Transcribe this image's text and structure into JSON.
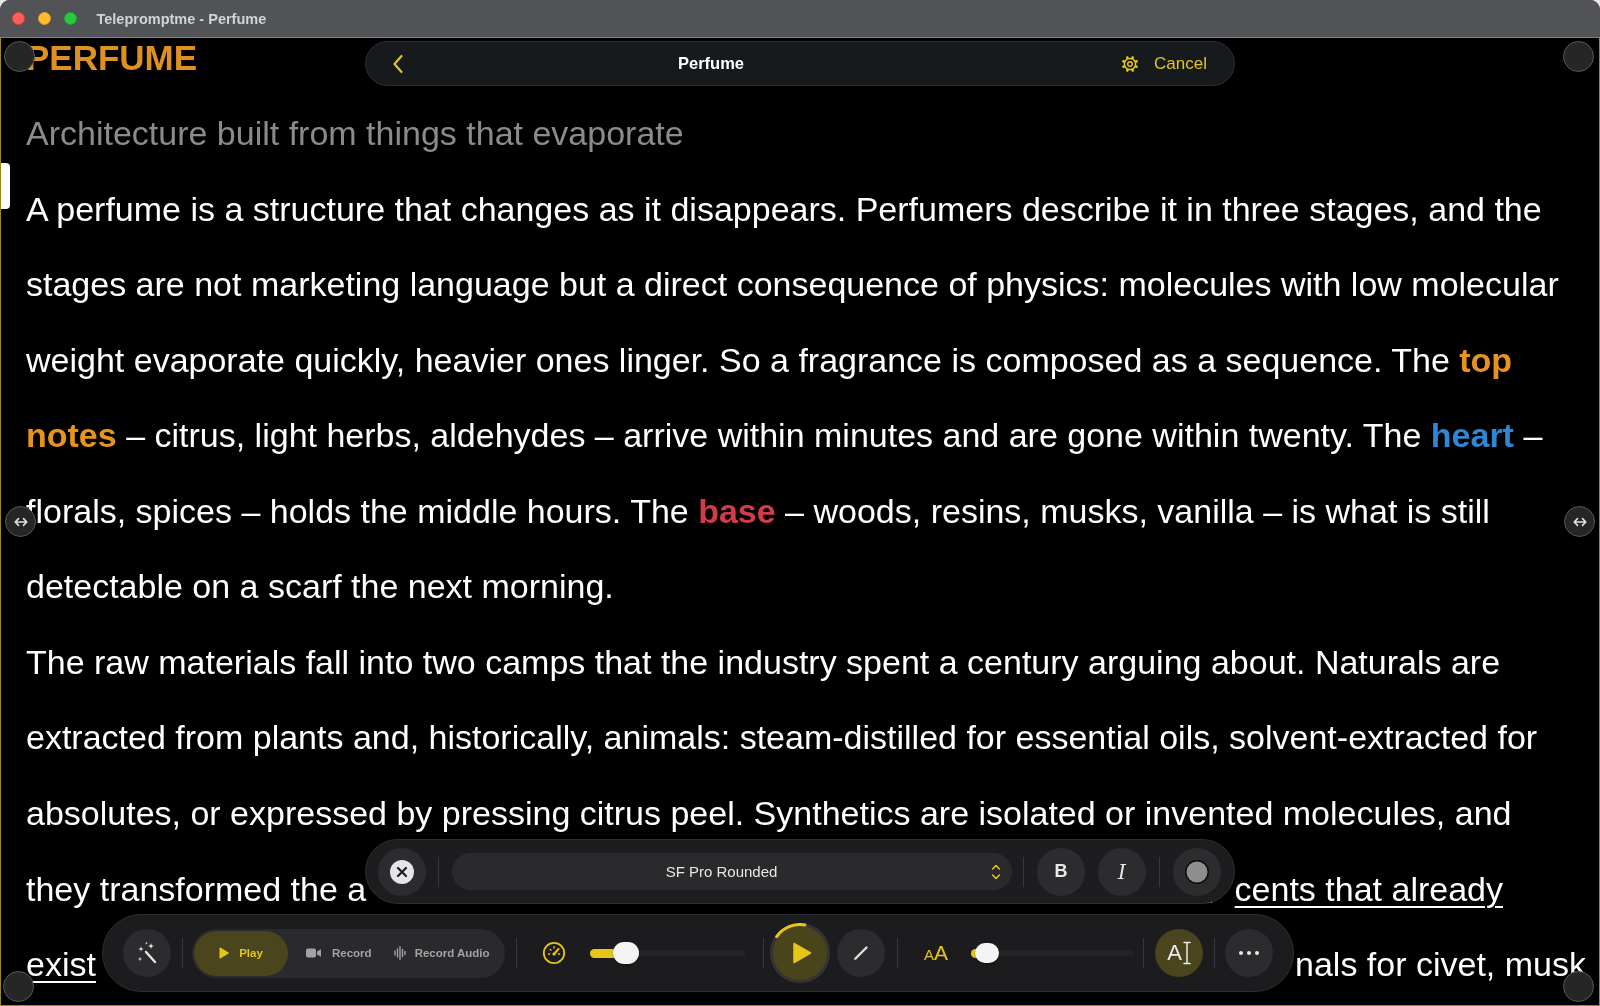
{
  "window": {
    "title": "Telepromptme - Perfume"
  },
  "document_title": "PERFUME",
  "nav_bar": {
    "title": "Perfume",
    "cancel_label": "Cancel"
  },
  "subtitle": "Architecture built from things that evaporate",
  "paragraphs": [
    {
      "lines": [
        [
          {
            "kind": "plain",
            "text": "A perfume is a structure that changes as it disappears. Perfumers describe it in three stages, and the"
          }
        ],
        [
          {
            "kind": "plain",
            "text": "stages are not marketing language but a direct consequence of physics: molecules with low molecular"
          }
        ],
        [
          {
            "kind": "plain",
            "text": "weight evaporate quickly, heavier ones linger. So a fragrance is composed as a sequence. The "
          },
          {
            "kind": "highlight",
            "text": "top",
            "color": "#e8931f"
          }
        ],
        [
          {
            "kind": "highlight",
            "text": "notes",
            "color": "#e8931f"
          },
          {
            "kind": "plain",
            "text": " – citrus, light herbs, aldehydes – arrive within minutes and are gone within twenty. The "
          },
          {
            "kind": "highlight",
            "text": "heart",
            "color": "#2e86d4"
          },
          {
            "kind": "plain",
            "text": " –"
          }
        ],
        [
          {
            "kind": "plain",
            "text": "florals, spices – holds the middle hours. The "
          },
          {
            "kind": "highlight",
            "text": "base",
            "color": "#d33a4a"
          },
          {
            "kind": "plain",
            "text": " – woods, resins, musks, vanilla – is what is still"
          }
        ],
        [
          {
            "kind": "plain",
            "text": "detectable on a scarf the next morning."
          }
        ]
      ]
    },
    {
      "lines": [
        [
          {
            "kind": "plain",
            "text": "The raw materials fall into two camps that the industry spent a century arguing about. Naturals are"
          }
        ],
        [
          {
            "kind": "plain",
            "text": "extracted from plants and, historically, animals: steam-distilled for essential oils, solvent-extracted for"
          }
        ],
        [
          {
            "kind": "plain",
            "text": "absolutes, or expressed by pressing citrus peel. Synthetics are isolated or invented molecules, and"
          }
        ]
      ]
    }
  ],
  "covered_lines": [
    {
      "left": {
        "text": "they transformed the a",
        "underlined": false
      },
      "right": {
        "text": "cents that already",
        "underlined": true
      }
    },
    {
      "left": {
        "text": "exist",
        "underlined": true
      },
      "right": {
        "text": "nals for civet, musk",
        "underlined": false
      }
    }
  ],
  "format_bar": {
    "font": "SF Pro Rounded",
    "bold_label": "B",
    "italic_label": "I",
    "color": "#8e8e8e"
  },
  "toolbar": {
    "modes": [
      {
        "kind": "play",
        "label": "Play",
        "selected": true
      },
      {
        "kind": "video",
        "label": "Record",
        "selected": false
      },
      {
        "kind": "audio",
        "label": "Record Audio",
        "selected": false
      }
    ],
    "speed": {
      "level": 0.23
    },
    "text_size": {
      "label": "AA",
      "level": 0.1
    },
    "text_button": {
      "label": "A",
      "on": true
    }
  }
}
